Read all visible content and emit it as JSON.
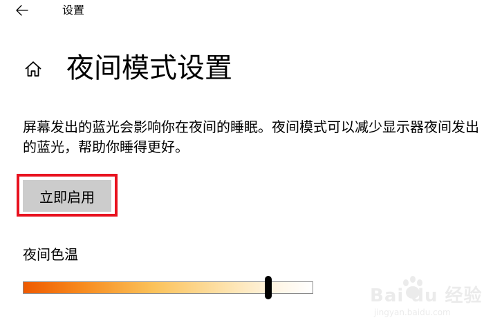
{
  "window": {
    "title": "设置",
    "back_icon": "back-arrow-icon"
  },
  "page": {
    "home_icon": "home-icon",
    "title": "夜间模式设置",
    "description": "屏幕发出的蓝光会影响你在夜间的睡眠。夜间模式可以减少显示器夜间发出的蓝光，帮助你睡得更好。"
  },
  "enable_button": {
    "label": "立即启用",
    "highlight_color": "#e8121f"
  },
  "color_temperature": {
    "label": "夜间色温",
    "value_fraction": 0.845,
    "gradient_start_color": "#ee5a00",
    "gradient_end_color": "#ffffff"
  },
  "watermark": {
    "main_text": "Bai du 经验",
    "sub_text": "jingyan.baidu.com"
  }
}
